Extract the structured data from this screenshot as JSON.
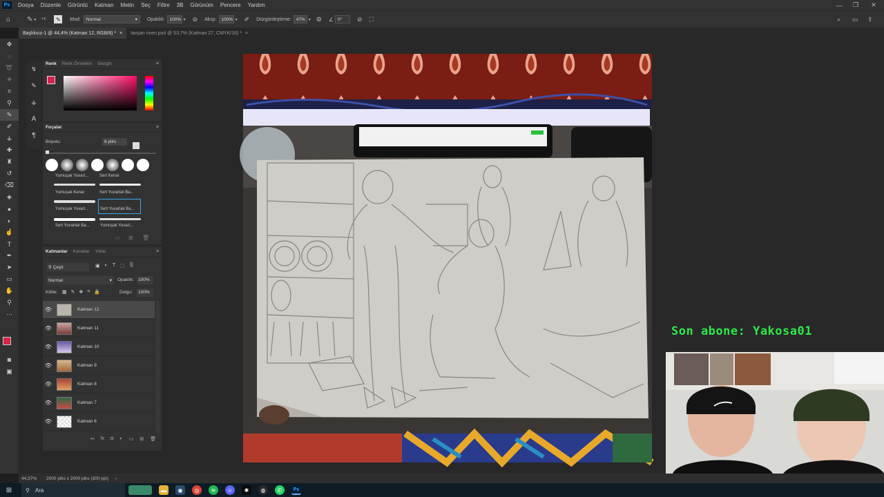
{
  "app": {
    "logo": "Ps",
    "menu": [
      "Dosya",
      "Düzenle",
      "Görüntü",
      "Katman",
      "Metin",
      "Seç",
      "Filtre",
      "3B",
      "Görünüm",
      "Pencere",
      "Yardım"
    ]
  },
  "options_bar": {
    "size_value": "6",
    "mode_label": "Mod:",
    "mode_value": "Normal",
    "opacity_label": "Opaklık:",
    "opacity_value": "100%",
    "flow_label": "Akışı:",
    "flow_value": "100%",
    "smoothing_label": "Düzgünleştirme:",
    "smoothing_value": "47%",
    "angle_value": "0°"
  },
  "tabs": [
    {
      "label": "Başlıksız-1 @ 44,4% (Katman 12, RGB/8) *",
      "active": true
    },
    {
      "label": "tavşan riven.psd @ 53,7% (Katman 27, CMYK/16) *",
      "active": false
    }
  ],
  "color_panel": {
    "tabs": [
      "Renk",
      "Renk Örnekleri",
      "Gezgin"
    ],
    "foreground_color": "#d8234a",
    "background_color": "#f2f2f2"
  },
  "brushes_panel": {
    "title": "Fırçalar",
    "size_label": "Boyutu:",
    "size_value": "6 piks",
    "brushes": [
      {
        "label": "Yumuşak Yuvarl..."
      },
      {
        "label": "Sert Kenar"
      },
      {
        "label": "Yumuşak Kenar"
      },
      {
        "label": "Sert Yuvarlak Ba..."
      },
      {
        "label": "Yumuşak Yuvarl..."
      },
      {
        "label": "Sert Yuvarlak Ba..."
      },
      {
        "label": "Sert Yuvarlak Ba..."
      },
      {
        "label": "Yumuşak Yuvarl..."
      }
    ]
  },
  "layers_panel": {
    "tabs": [
      "Katmanlar",
      "Kanallar",
      "Yollar"
    ],
    "filter_label": "Çeşit",
    "blend_mode": "Normal",
    "opacity_label": "Opaklık:",
    "opacity_value": "100%",
    "lock_label": "Kilitle:",
    "fill_label": "Dolgu:",
    "fill_value": "100%",
    "layers": [
      {
        "name": "Katman 12",
        "selected": true
      },
      {
        "name": "Katman 11",
        "selected": false
      },
      {
        "name": "Katman 10",
        "selected": false
      },
      {
        "name": "Katman 9",
        "selected": false
      },
      {
        "name": "Katman 8",
        "selected": false
      },
      {
        "name": "Katman 7",
        "selected": false
      },
      {
        "name": "Katman 6",
        "selected": false
      }
    ]
  },
  "status": {
    "zoom": "44,37%",
    "doc_info": "2000 piks x 2000 piks (300 ppi)"
  },
  "overlay": {
    "subscriber_text": "Son abone: Yakosa01",
    "subscriber_color": "#2ee84a"
  },
  "taskbar": {
    "search_placeholder": "Ara"
  }
}
